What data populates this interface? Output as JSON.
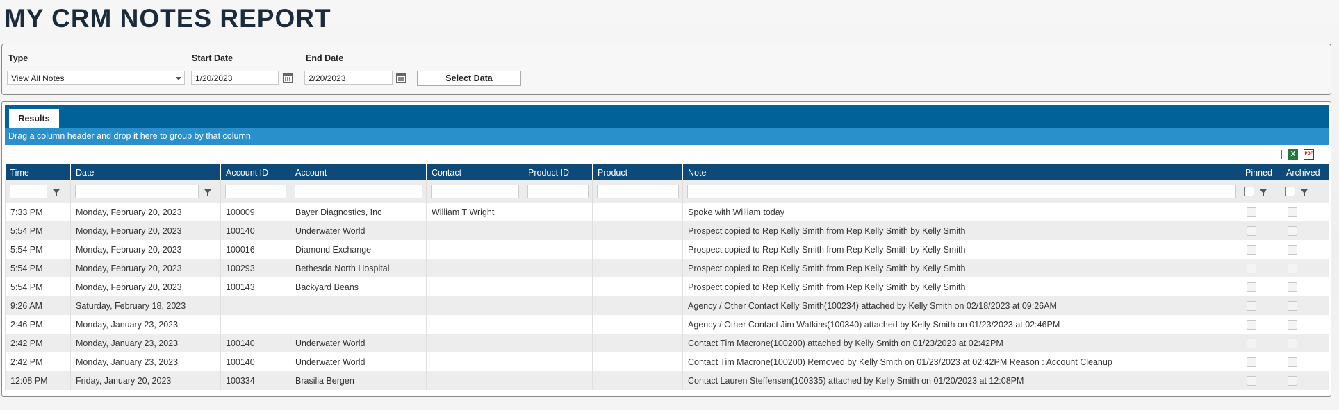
{
  "page_title": "MY CRM NOTES REPORT",
  "filters": {
    "type_label": "Type",
    "type_value": "View All Notes",
    "start_label": "Start Date",
    "start_value": "1/20/2023",
    "end_label": "End Date",
    "end_value": "2/20/2023",
    "select_button": "Select Data"
  },
  "results": {
    "tab_label": "Results",
    "group_hint": "Drag a column header and drop it here to group by that column",
    "export_icons": [
      "excel-export-icon",
      "pdf-export-icon"
    ],
    "columns": [
      "Time",
      "Date",
      "Account ID",
      "Account",
      "Contact",
      "Product ID",
      "Product",
      "Note",
      "Pinned",
      "Archived"
    ],
    "rows": [
      {
        "time": "7:33 PM",
        "date": "Monday, February 20, 2023",
        "account_id": "100009",
        "account": "Bayer Diagnostics, Inc",
        "contact": "William T Wright",
        "product_id": "",
        "product": "",
        "note": "Spoke with William today",
        "pinned": false,
        "archived": false
      },
      {
        "time": "5:54 PM",
        "date": "Monday, February 20, 2023",
        "account_id": "100140",
        "account": "Underwater World",
        "contact": "",
        "product_id": "",
        "product": "",
        "note": "Prospect copied to Rep Kelly Smith from Rep Kelly Smith by Kelly Smith",
        "pinned": false,
        "archived": false
      },
      {
        "time": "5:54 PM",
        "date": "Monday, February 20, 2023",
        "account_id": "100016",
        "account": "Diamond Exchange",
        "contact": "",
        "product_id": "",
        "product": "",
        "note": "Prospect copied to Rep Kelly Smith from Rep Kelly Smith by Kelly Smith",
        "pinned": false,
        "archived": false
      },
      {
        "time": "5:54 PM",
        "date": "Monday, February 20, 2023",
        "account_id": "100293",
        "account": "Bethesda North Hospital",
        "contact": "",
        "product_id": "",
        "product": "",
        "note": "Prospect copied to Rep Kelly Smith from Rep Kelly Smith by Kelly Smith",
        "pinned": false,
        "archived": false
      },
      {
        "time": "5:54 PM",
        "date": "Monday, February 20, 2023",
        "account_id": "100143",
        "account": "Backyard Beans",
        "contact": "",
        "product_id": "",
        "product": "",
        "note": "Prospect copied to Rep Kelly Smith from Rep Kelly Smith by Kelly Smith",
        "pinned": false,
        "archived": false
      },
      {
        "time": "9:26 AM",
        "date": "Saturday, February 18, 2023",
        "account_id": "",
        "account": "",
        "contact": "",
        "product_id": "",
        "product": "",
        "note": "Agency / Other Contact Kelly Smith(100234) attached by Kelly Smith on 02/18/2023 at 09:26AM",
        "pinned": false,
        "archived": false
      },
      {
        "time": "2:46 PM",
        "date": "Monday, January 23, 2023",
        "account_id": "",
        "account": "",
        "contact": "",
        "product_id": "",
        "product": "",
        "note": "Agency / Other Contact Jim Watkins(100340) attached by Kelly Smith on 01/23/2023 at 02:46PM",
        "pinned": false,
        "archived": false
      },
      {
        "time": "2:42 PM",
        "date": "Monday, January 23, 2023",
        "account_id": "100140",
        "account": "Underwater World",
        "contact": "",
        "product_id": "",
        "product": "",
        "note": "Contact Tim Macrone(100200) attached by Kelly Smith on 01/23/2023 at 02:42PM",
        "pinned": false,
        "archived": false
      },
      {
        "time": "2:42 PM",
        "date": "Monday, January 23, 2023",
        "account_id": "100140",
        "account": "Underwater World",
        "contact": "",
        "product_id": "",
        "product": "",
        "note": "Contact Tim Macrone(100200) Removed by Kelly Smith on 01/23/2023 at 02:42PM Reason : Account Cleanup",
        "pinned": false,
        "archived": false
      },
      {
        "time": "12:08 PM",
        "date": "Friday, January 20, 2023",
        "account_id": "100334",
        "account": "Brasilia Bergen",
        "contact": "",
        "product_id": "",
        "product": "",
        "note": "Contact Lauren Steffensen(100335) attached by Kelly Smith on 01/20/2023 at 12:08PM",
        "pinned": false,
        "archived": false
      }
    ]
  },
  "colors": {
    "tab_bar": "#006298",
    "group_bar": "#2a90cc",
    "header": "#0d4a7a",
    "title": "#1c2b3c"
  }
}
